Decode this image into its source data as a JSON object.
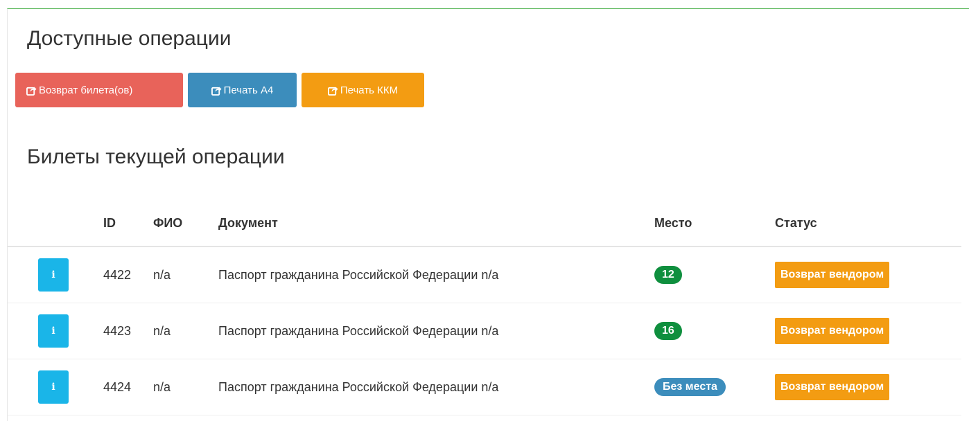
{
  "operations": {
    "title": "Доступные операции",
    "buttons": {
      "refund": "Возврат билета(ов)",
      "print_a4": "Печать А4",
      "print_kkm": " Печать ККМ"
    }
  },
  "tickets": {
    "title": "Билеты текущей операции",
    "columns": {
      "id": "ID",
      "fio": "ФИО",
      "document": "Документ",
      "seat": "Место",
      "status": "Статус"
    },
    "rows": [
      {
        "info": "i",
        "id": "4422",
        "fio": "n/a",
        "document": "Паспорт гражданина Российской Федерации n/a",
        "seat": "12",
        "status": "Возврат вендором"
      },
      {
        "info": "i",
        "id": "4423",
        "fio": "n/a",
        "document": "Паспорт гражданина Российской Федерации n/a",
        "seat": "16",
        "status": "Возврат вендором"
      },
      {
        "info": "i",
        "id": "4424",
        "fio": "n/a",
        "document": "Паспорт гражданина Российской Федерации n/a",
        "seat": "Без места",
        "status": "Возврат вендором"
      }
    ]
  },
  "colors": {
    "danger": "#e8635a",
    "primary": "#3c8dbc",
    "warning": "#f39c12",
    "info": "#1ab5e8",
    "success": "#0f8f3e"
  }
}
